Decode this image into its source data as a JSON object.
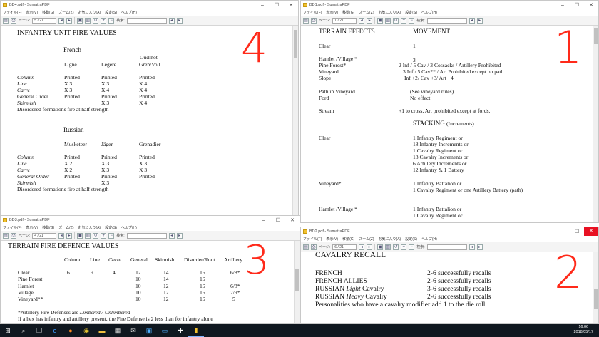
{
  "windows": {
    "w4": {
      "title": "BD4.pdf - SumatraPDF",
      "page": "5 / 21",
      "corner_number": "4",
      "heading": "INFANTRY UNIT FIRE VALUES",
      "french_label": "French",
      "french_cols": [
        "Ligne",
        "Legere",
        "Oudinot",
        "Gren/Volt"
      ],
      "french_rows": [
        [
          "Column",
          "Printed",
          "Printed",
          "Printed"
        ],
        [
          "Line",
          "X 3",
          "X 3",
          "X 4"
        ],
        [
          "Carre",
          "X 3",
          "X 4",
          "X 4"
        ],
        [
          "General Order",
          "Printed",
          "Printed",
          "Printed"
        ],
        [
          "Skirmish",
          "",
          "X 3",
          "X 4"
        ]
      ],
      "french_note": "Disordered formations fire at half strength",
      "russian_label": "Russian",
      "russian_cols": [
        "Musketeer",
        "Jäger",
        "Grenadier"
      ],
      "russian_rows": [
        [
          "Column",
          "Printed",
          "Printed",
          "Printed"
        ],
        [
          "Line",
          "X 2",
          "X 3",
          "X 3"
        ],
        [
          "Carre",
          "X 2",
          "X 3",
          "X 3"
        ],
        [
          "General Order",
          "Printed",
          "Printed",
          "Printed"
        ],
        [
          "Skirmish",
          "",
          "X 3",
          ""
        ]
      ],
      "russian_note": "Disordered formations fire at half strength"
    },
    "w1": {
      "title": "BD1.pdf - SumatraPDF",
      "page": "1 / 21",
      "corner_number": "1",
      "heading_left": "TERRAIN EFFECTS",
      "heading_right": "MOVEMENT",
      "rows": [
        [
          "Clear",
          "1"
        ],
        [
          "Hamlet /Village *",
          "3"
        ],
        [
          "Pine Forest*",
          "2 Inf / 5 Cav  / 3 Cossacks / Artillery Prohibited"
        ],
        [
          "Vineyard",
          "3 Inf / 5 Cav** / Art Prohibited except on path"
        ],
        [
          "Slope",
          "Inf +2/ Cav +3/ Art +4"
        ],
        [
          "Path in Vineyard",
          "(See vineyard rules)"
        ],
        [
          "Ford",
          "No effect"
        ],
        [
          "Stream",
          "+1 to cross, Art prohibited except at fords."
        ]
      ],
      "stacking_title": "STACKING",
      "stacking_sub": "(Increments)",
      "stacking": [
        {
          "label": "Clear",
          "lines": [
            "1 Infantry Regiment or",
            "18 Infantry Increments or",
            "1 Cavalry Regiment or",
            "18 Cavalry Increments or",
            "6 Artillery Increments or",
            "12 Infantry & 1 Battery"
          ]
        },
        {
          "label": "Vineyard*",
          "lines": [
            "1 Infantry Battalion or",
            "1 Cavalry Regiment or one Artillery Battery (path)"
          ]
        },
        {
          "label": "Hamlet /Village *",
          "lines": [
            "1 Infantry Battalion or",
            "1 Cavalry Regiment or"
          ]
        }
      ]
    },
    "w3": {
      "title": "BD3.pdf - SumatraPDF",
      "page": "4 / 21",
      "corner_number": "3",
      "heading": "TERRAIN FIRE DEFENCE VALUES",
      "cols": [
        "Column",
        "Line",
        "Carre",
        "General",
        "Skirmish",
        "Disorder/Rout",
        "Artillery"
      ],
      "rows": [
        [
          "Clear",
          "6",
          "9",
          "4",
          "12",
          "14",
          "16",
          "6/8*"
        ],
        [
          "Pine Forest",
          "",
          "",
          "",
          "10",
          "14",
          "16",
          ""
        ],
        [
          "Hamlet",
          "",
          "",
          "",
          "10",
          "12",
          "16",
          "6/8*"
        ],
        [
          "Village",
          "",
          "",
          "",
          "10",
          "12",
          "16",
          "7/9*"
        ],
        [
          "Vineyard**",
          "",
          "",
          "",
          "10",
          "12",
          "16",
          "5"
        ]
      ],
      "note1_a": "*Artillery Fire Defenses are ",
      "note1_b": "Limbered / Unlimbered",
      "note2": "If a hex has infantry and artillery present, the Fire Defense is 2 less than for infantry alone"
    },
    "w2": {
      "title": "BD2.pdf - SumatraPDF",
      "page": "6 / 21",
      "corner_number": "2",
      "heading": "CAVALRY RECALL",
      "rows": [
        {
          "a": "FRENCH",
          "b": "",
          "c": "",
          "val": "2-6 successfully recalls"
        },
        {
          "a": "FRENCH ALLIES",
          "b": "",
          "c": "",
          "val": "2-6 successfully recalls"
        },
        {
          "a": "RUSSIAN ",
          "b": "Light",
          "c": " Cavalry",
          "val": "3-6 successfully recalls"
        },
        {
          "a": "RUSSIAN ",
          "b": "Heavy",
          "c": " Cavalry",
          "val": "2-6 successfully recalls"
        }
      ],
      "footer": "Personalities who have a cavalry modifier add 1 to the die roll"
    }
  },
  "menu": [
    "ファイル(F)",
    "表示(V)",
    "移動(G)",
    "ズーム(Z)",
    "お気に入り(A)",
    "設定(S)",
    "ヘルプ(H)"
  ],
  "toolbar": {
    "page_label": "ページ:",
    "search_label": "検索:"
  },
  "taskbar": {
    "time": "16:06",
    "date": "2018/05/17"
  }
}
